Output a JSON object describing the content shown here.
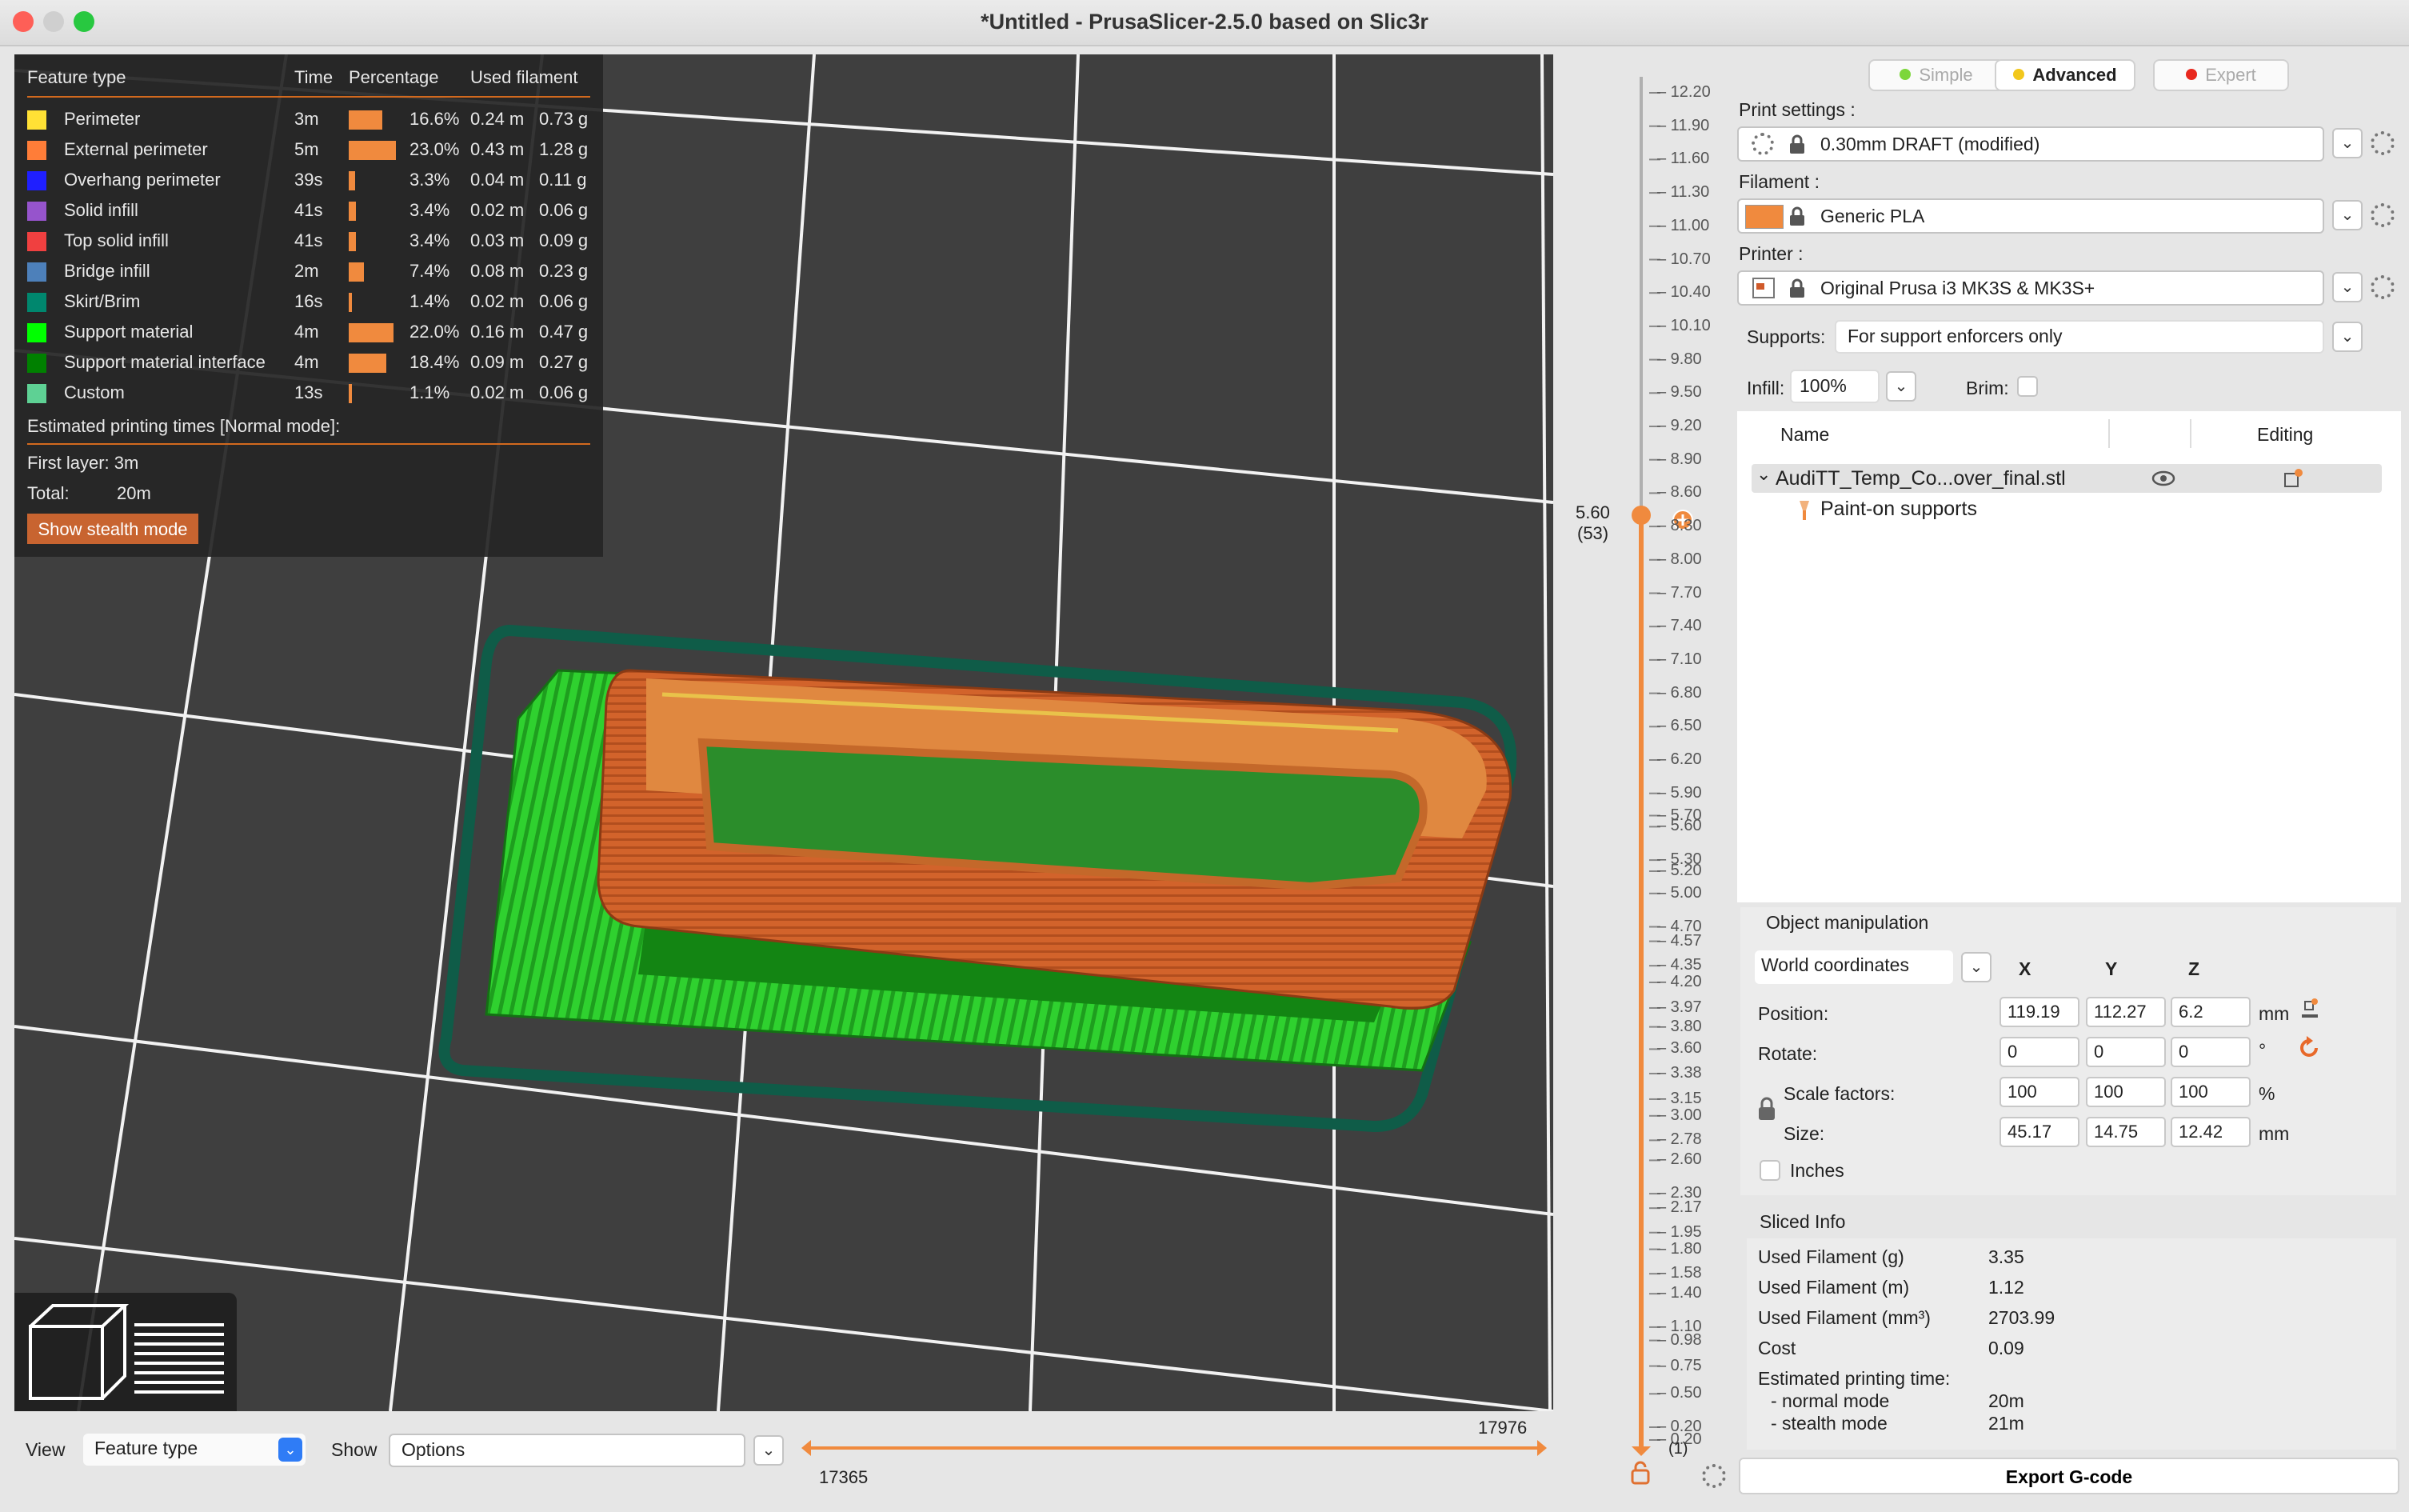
{
  "window": {
    "title": "*Untitled - PrusaSlicer-2.5.0 based on Slic3r"
  },
  "legend": {
    "headers": {
      "feature": "Feature type",
      "time": "Time",
      "percentage": "Percentage",
      "filament": "Used filament"
    },
    "rows": [
      {
        "name": "Perimeter",
        "color": "#ffe135",
        "time": "3m",
        "percent": "16.6%",
        "pct_value": 16.6,
        "meters": "0.24 m",
        "grams": "0.73 g"
      },
      {
        "name": "External perimeter",
        "color": "#ff7d38",
        "time": "5m",
        "percent": "23.0%",
        "pct_value": 23.0,
        "meters": "0.43 m",
        "grams": "1.28 g"
      },
      {
        "name": "Overhang perimeter",
        "color": "#1f1fff",
        "time": "39s",
        "percent": "3.3%",
        "pct_value": 3.3,
        "meters": "0.04 m",
        "grams": "0.11 g"
      },
      {
        "name": "Solid infill",
        "color": "#9654cc",
        "time": "41s",
        "percent": "3.4%",
        "pct_value": 3.4,
        "meters": "0.02 m",
        "grams": "0.06 g"
      },
      {
        "name": "Top solid infill",
        "color": "#f04040",
        "time": "41s",
        "percent": "3.4%",
        "pct_value": 3.4,
        "meters": "0.03 m",
        "grams": "0.09 g"
      },
      {
        "name": "Bridge infill",
        "color": "#4d80ba",
        "time": "2m",
        "percent": "7.4%",
        "pct_value": 7.4,
        "meters": "0.08 m",
        "grams": "0.23 g"
      },
      {
        "name": "Skirt/Brim",
        "color": "#00876e",
        "time": "16s",
        "percent": "1.4%",
        "pct_value": 1.4,
        "meters": "0.02 m",
        "grams": "0.06 g"
      },
      {
        "name": "Support material",
        "color": "#00ff00",
        "time": "4m",
        "percent": "22.0%",
        "pct_value": 22.0,
        "meters": "0.16 m",
        "grams": "0.47 g"
      },
      {
        "name": "Support material interface",
        "color": "#008000",
        "time": "4m",
        "percent": "18.4%",
        "pct_value": 18.4,
        "meters": "0.09 m",
        "grams": "0.27 g"
      },
      {
        "name": "Custom",
        "color": "#5ed194",
        "time": "13s",
        "percent": "1.1%",
        "pct_value": 1.1,
        "meters": "0.02 m",
        "grams": "0.06 g"
      }
    ],
    "estimated_label": "Estimated printing times [Normal mode]:",
    "first_layer": "First layer: 3m",
    "total_label": "Total:",
    "total_value": "20m",
    "stealth_button": "Show stealth mode"
  },
  "bottom": {
    "view_label": "View",
    "view_value": "Feature type",
    "show_label": "Show",
    "show_value": "Options",
    "slider_max": "17976",
    "slider_min": "17365"
  },
  "layer_slider": {
    "ticks": [
      "12.20",
      "11.90",
      "11.60",
      "11.30",
      "11.00",
      "10.70",
      "10.40",
      "10.10",
      "9.80",
      "9.50",
      "9.20",
      "8.90",
      "8.60",
      "8.30",
      "8.00",
      "7.70",
      "7.40",
      "7.10",
      "6.80",
      "6.50",
      "6.20",
      "5.90",
      "5.70",
      "5.60",
      "5.30",
      "5.20",
      "5.00",
      "4.70",
      "4.57",
      "4.35",
      "4.20",
      "3.97",
      "3.80",
      "3.60",
      "3.38",
      "3.15",
      "3.00",
      "2.78",
      "2.60",
      "2.30",
      "2.17",
      "1.95",
      "1.80",
      "1.58",
      "1.40",
      "1.10",
      "0.98",
      "0.75",
      "0.50",
      "0.20",
      "0.20"
    ],
    "current_value": "5.60",
    "current_layer": "(53)",
    "bottom_layer": "(1)"
  },
  "modes": {
    "simple": "Simple",
    "advanced": "Advanced",
    "expert": "Expert",
    "simple_color": "#7cd63a",
    "advanced_color": "#f2c71c",
    "expert_color": "#e8281e"
  },
  "print_settings": {
    "label": "Print settings :",
    "value": "0.30mm DRAFT (modified)"
  },
  "filament": {
    "label": "Filament :",
    "value": "Generic PLA",
    "color": "#f08a3e"
  },
  "printer": {
    "label": "Printer :",
    "value": "Original Prusa i3 MK3S & MK3S+"
  },
  "supports": {
    "label": "Supports:",
    "value": "For support enforcers only"
  },
  "infill": {
    "label": "Infill:",
    "value": "100%"
  },
  "brim": {
    "label": "Brim:"
  },
  "object_list": {
    "col_name": "Name",
    "col_editing": "Editing",
    "object": "AudiTT_Temp_Co...over_final.stl",
    "child": "Paint-on supports"
  },
  "manip": {
    "title": "Object manipulation",
    "coords": "World coordinates",
    "x": "X",
    "y": "Y",
    "z": "Z",
    "position": {
      "label": "Position:",
      "x": "119.19",
      "y": "112.27",
      "z": "6.2",
      "unit": "mm"
    },
    "rotate": {
      "label": "Rotate:",
      "x": "0",
      "y": "0",
      "z": "0",
      "unit": "°"
    },
    "scale": {
      "label": "Scale factors:",
      "x": "100",
      "y": "100",
      "z": "100",
      "unit": "%"
    },
    "size": {
      "label": "Size:",
      "x": "45.17",
      "y": "14.75",
      "z": "12.42",
      "unit": "mm"
    },
    "inches": "Inches"
  },
  "sliced": {
    "title": "Sliced Info",
    "rows": [
      {
        "label": "Used Filament (g)",
        "value": "3.35"
      },
      {
        "label": "Used Filament (m)",
        "value": "1.12"
      },
      {
        "label": "Used Filament (mm³)",
        "value": "2703.99"
      },
      {
        "label": "Cost",
        "value": "0.09"
      }
    ],
    "est_label": "Estimated printing time:",
    "normal_label": "- normal mode",
    "normal_value": "20m",
    "stealth_label": "- stealth mode",
    "stealth_value": "21m"
  },
  "export_button": "Export G-code"
}
